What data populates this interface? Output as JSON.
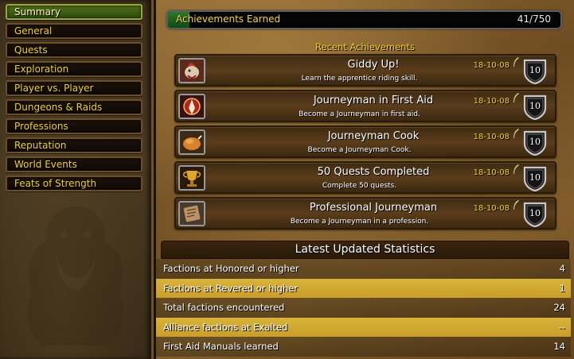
{
  "sidebar": {
    "categories": [
      {
        "label": "Summary"
      },
      {
        "label": "General"
      },
      {
        "label": "Quests"
      },
      {
        "label": "Exploration"
      },
      {
        "label": "Player vs. Player"
      },
      {
        "label": "Dungeons & Raids"
      },
      {
        "label": "Professions"
      },
      {
        "label": "Reputation"
      },
      {
        "label": "World Events"
      },
      {
        "label": "Feats of Strength"
      }
    ],
    "active_index": 0
  },
  "progress": {
    "label": "Achievements Earned",
    "count_text": "41/750",
    "earned": 41,
    "total": 750
  },
  "recent": {
    "title": "Recent Achievements",
    "items": [
      {
        "title": "Giddy Up!",
        "description": "Learn the apprentice riding skill.",
        "date": "18-10-08",
        "points": "10",
        "icon": "horse-icon"
      },
      {
        "title": "Journeyman in First Aid",
        "description": "Become a Journeyman in first aid.",
        "date": "18-10-08",
        "points": "10",
        "icon": "first-aid-icon"
      },
      {
        "title": "Journeyman Cook",
        "description": "Become a Journeyman Cook.",
        "date": "18-10-08",
        "points": "10",
        "icon": "roast-chicken-icon"
      },
      {
        "title": "50 Quests Completed",
        "description": "Complete 50 quests.",
        "date": "18-10-08",
        "points": "10",
        "icon": "trophy-cup-icon"
      },
      {
        "title": "Professional Journeyman",
        "description": "Become a Journeyman in a profession.",
        "date": "18-10-08",
        "points": "10",
        "icon": "scroll-icon"
      }
    ]
  },
  "statistics": {
    "title": "Latest Updated Statistics",
    "rows": [
      {
        "label": "Factions at Honored or higher",
        "value": "4"
      },
      {
        "label": "Factions at Revered or higher",
        "value": "1"
      },
      {
        "label": "Total factions encountered",
        "value": "24"
      },
      {
        "label": "Alliance factions at Exalted",
        "value": "--"
      },
      {
        "label": "First Aid Manuals learned",
        "value": "14"
      }
    ]
  },
  "colors": {
    "gold_text": "#f3cf2c",
    "progress_fill": "#1f6a1f",
    "active_category": "#3d5d12"
  }
}
